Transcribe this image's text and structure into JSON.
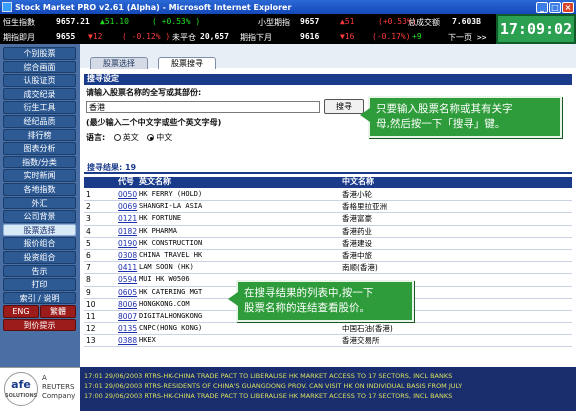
{
  "window": {
    "title": "Stock Market PRO v2.61 (Alpha) - Microsoft Internet Explorer",
    "minimize_label": "_",
    "maximize_label": "□",
    "close_label": "×"
  },
  "ticker": {
    "row1": {
      "label1": "恒生指數",
      "value1": "9657.21",
      "change1": "▲51.10",
      "pct1": "( +0.53% )",
      "label2": "小型期指",
      "value2": "9657",
      "change2": "▲51",
      "pct2": "(+0.53%)",
      "label3": "总成交额",
      "value3": "7.603B"
    },
    "row2": {
      "label1": "期指即月",
      "value1": "9655",
      "change1": "▼12",
      "pct1": "( -0.12% )",
      "label2": "未平仓",
      "value2": "20,657",
      "label3": "期指下月",
      "value3": "9616",
      "change3": "▼16",
      "pct3": "(-0.17%)",
      "extra": "+9",
      "next_page": "下一页 >>"
    },
    "clock": "17:09:02"
  },
  "nav": {
    "items": [
      "个别股票",
      "综合画面",
      "认股证页",
      "成交纪录",
      "衍生工具",
      "经纪品质",
      "排行榜",
      "图表分析",
      "指数/分类",
      "实时新闻",
      "各地指数",
      "外汇",
      "公司背景",
      "股票选择",
      "报价组合",
      "投资组合",
      "告示",
      "打印",
      "索引 / 说明"
    ],
    "active_index": 13,
    "lang_en": "ENG",
    "lang_trad": "繁體",
    "expire": "到价提示"
  },
  "tabs": {
    "tab1": "股票选择",
    "tab2": "股票搜寻"
  },
  "search": {
    "section_title": "搜寻设定",
    "prompt": "请输入股票名称的全写或其部份:",
    "input_value": "香港",
    "button": "搜寻",
    "hint": "(最少输入二个中文字或些个英文字母)",
    "lang_label": "语言:",
    "opt_en": "英文",
    "opt_zh": "中文"
  },
  "results": {
    "title": "搜寻结果: 19",
    "headers": {
      "code": "代号",
      "en": "英文名称",
      "zh": "中文名称"
    },
    "rows": [
      {
        "i": "1",
        "code": "0050",
        "en": "HK FERRY (HOLD)",
        "zh": "香港小轮"
      },
      {
        "i": "2",
        "code": "0069",
        "en": "SHANGRI-LA ASIA",
        "zh": "香格里拉亚洲"
      },
      {
        "i": "3",
        "code": "0121",
        "en": "HK FORTUNE",
        "zh": "香港富豪"
      },
      {
        "i": "4",
        "code": "0182",
        "en": "HK PHARMA",
        "zh": "香港药业"
      },
      {
        "i": "5",
        "code": "0190",
        "en": "HK CONSTRUCTION",
        "zh": "香港建设"
      },
      {
        "i": "6",
        "code": "0308",
        "en": "CHINA TRAVEL HK",
        "zh": "香港中旅"
      },
      {
        "i": "7",
        "code": "0411",
        "en": "LAM SOON (HK)",
        "zh": "南顺(香港)"
      },
      {
        "i": "8",
        "code": "0594",
        "en": "MUI HK W0506",
        "zh": ""
      },
      {
        "i": "9",
        "code": "0605",
        "en": "HK CATERING MGT",
        "zh": ""
      },
      {
        "i": "10",
        "code": "8006",
        "en": "HONGKONG.COM",
        "zh": ""
      },
      {
        "i": "11",
        "code": "8007",
        "en": "DIGITALHONGKONG",
        "zh": "数码香港"
      },
      {
        "i": "12",
        "code": "0135",
        "en": "CNPC(HONG KONG)",
        "zh": "中国石油(香港)"
      },
      {
        "i": "13",
        "code": "0388",
        "en": "HKEX",
        "zh": "香港交易所"
      }
    ]
  },
  "callouts": {
    "c1_line1": "只要输入股票名称或其有关字",
    "c1_line2": "母,然后按一下「搜寻」键。",
    "c2_line1": "在搜寻结果的列表中,按一下",
    "c2_line2": "股票名称的连结查看股价。"
  },
  "logo": {
    "afe": "afe",
    "afe_sub": "SOLUTIONS",
    "reuters_line1": "A",
    "reuters_line2": "REUTERS",
    "reuters_line3": "Company"
  },
  "news": [
    "17:01 29/06/2003 RTRS-HK-CHINA TRADE PACT TO LIBERALISE HK MARKET ACCESS TO 17 SECTORS, INCL BANKS",
    "17:01 29/06/2003 RTRS-RESIDENTS OF CHINA'S GUANGDONG PROV. CAN VISIT HK ON INDIVIDUAL BASIS FROM JULY",
    "17:00 29/06/2003 RTRS-HK-CHINA TRADE PACT TO LIBERALISE HK MARKET ACCESS TO 17 SECTORS, INCL BANKS"
  ]
}
